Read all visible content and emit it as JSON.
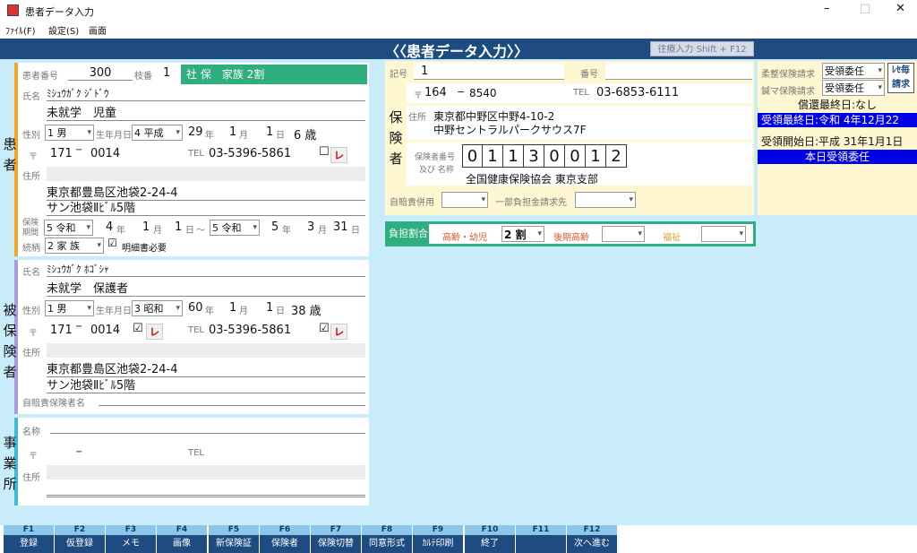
{
  "window": {
    "title": "患者データ入力",
    "min": "–",
    "max": "□",
    "close": "✕"
  },
  "menu": [
    "ﾌｧｲﾙ(F)",
    "設定(S)",
    "画面"
  ],
  "header": {
    "title": "〈〈患者データ入力〉〉",
    "shortcut": "往療入力 Shift + F12"
  },
  "patient": {
    "side_label": [
      "患",
      "者"
    ],
    "number_label": "患者番号",
    "number": "300",
    "branch_label": "枝番",
    "branch": "1",
    "insurance_type": "社 保　家族 2割",
    "name_label": "氏名",
    "name_kana": "ﾐｼｭｳｶﾞｸ ｼﾞﾄﾞｳ",
    "name": "未就学　児童",
    "sex_label": "性別",
    "sex": "1 男",
    "birth_label": "生年月日",
    "era": "4 平成",
    "year": "29",
    "year_unit": "年",
    "month": "1",
    "month_unit": "月",
    "day": "1",
    "day_unit": "日",
    "age": "6 歳",
    "zip_label": "〒",
    "zip1": "171",
    "zip_sep": "−",
    "zip2": "0014",
    "tel_label": "TEL",
    "tel": "03-5396-5861",
    "check": "☐",
    "l_badge": "レ",
    "addr_label": "住所",
    "addr1": "東京都豊島区池袋2-24-4",
    "addr2": "サン池袋Ⅱﾋﾞﾙ5階",
    "period_label1": "保険",
    "period_label2": "期間",
    "p_start_era": "5 令和",
    "p_start_year": "4",
    "p_start_month": "1",
    "p_start_day": "1",
    "p_sep": "〜",
    "p_end_era": "5 令和",
    "p_end_year": "5",
    "p_end_month": "3",
    "p_end_day": "31",
    "rel_label": "続柄",
    "relation": "2 家 族",
    "detail_check": "☑",
    "detail_label": "明細書必要"
  },
  "insured": {
    "side_label": [
      "被",
      "保",
      "険",
      "者"
    ],
    "name_label": "氏名",
    "name_kana": "ﾐｼｭｳｶﾞｸ ﾎｺﾞｼｬ",
    "name": "未就学　保護者",
    "sex_label": "性別",
    "sex": "1 男",
    "birth_label": "生年月日",
    "era": "3 昭和",
    "year": "60",
    "year_unit": "年",
    "month": "1",
    "month_unit": "月",
    "day": "1",
    "day_unit": "日",
    "age": "38 歳",
    "zip_label": "〒",
    "zip1": "171",
    "zip_sep": "−",
    "zip2": "0014",
    "check1": "☑",
    "l_badge": "レ",
    "tel_label": "TEL",
    "tel": "03-5396-5861",
    "check2": "☑",
    "addr_label": "住所",
    "addr1": "東京都豊島区池袋2-24-4",
    "addr2": "サン池袋Ⅱﾋﾞﾙ5階",
    "jibai_label": "自賠責保険者名"
  },
  "office": {
    "side_label": [
      "事",
      "業",
      "所"
    ],
    "name_label": "名称",
    "zip_label": "〒",
    "zip_sep": "−",
    "tel_label": "TEL",
    "addr_label": "住所"
  },
  "insurer": {
    "kigo_label": "記号",
    "kigo": "1",
    "bango_label": "番号",
    "bango": "",
    "side_label": [
      "保",
      "険",
      "者"
    ],
    "zip_label": "〒",
    "zip1": "164",
    "zip_sep": "−",
    "zip2": "8540",
    "tel_label": "TEL",
    "tel": "03-6853-6111",
    "addr_label": "住所",
    "addr1": "東京都中野区中野4-10-2",
    "addr2": "中野セントラルパークサウス7F",
    "num_label1": "保険者番号",
    "num_label2": "及び 名称",
    "digits": [
      "0",
      "1",
      "1",
      "3",
      "0",
      "0",
      "1",
      "2"
    ],
    "name": "全国健康保険協会 東京支部",
    "jibai_label": "自賠責併用",
    "partial_label": "一部負担金請求先"
  },
  "right": {
    "judo_label": "柔整保険請求",
    "judo": "受領委任",
    "shinkyu_label": "鍼マ保険請求",
    "shinkyu": "受領委任",
    "reze_btn1": "ﾚｾ毎",
    "reze_btn2": "請求",
    "last_refund": "償還最終日:なし",
    "last_receipt": "受領最終日:令和 4年12月22",
    "start_receipt": "受領開始日:平成 31年1月1日",
    "today": "本日受領委任"
  },
  "burden": {
    "label": "負担割合",
    "elderly_label": "高齢・幼児",
    "elderly": "2 割",
    "late_label": "後期高齢",
    "late": "",
    "welfare_label": "福祉",
    "welfare": ""
  },
  "fkeys": [
    {
      "key": "F1",
      "label": "登録"
    },
    {
      "key": "F2",
      "label": "仮登録"
    },
    {
      "key": "F3",
      "label": "メモ"
    },
    {
      "key": "F4",
      "label": "画像"
    },
    {
      "key": "F5",
      "label": "新保険証"
    },
    {
      "key": "F6",
      "label": "保険者"
    },
    {
      "key": "F7",
      "label": "保険切替"
    },
    {
      "key": "F8",
      "label": "同意形式"
    },
    {
      "key": "F9",
      "label": "ｶﾙﾃ印刷"
    },
    {
      "key": "F10",
      "label": "終了"
    },
    {
      "key": "F11",
      "label": ""
    },
    {
      "key": "F12",
      "label": "次へ進む"
    }
  ],
  "colors": {
    "header": "#1f4c80",
    "accent_green": "#2fae7f",
    "cyan_bg": "#c8ecfa",
    "beige": "#fff6d2",
    "blue_bar": "#0000e6"
  }
}
